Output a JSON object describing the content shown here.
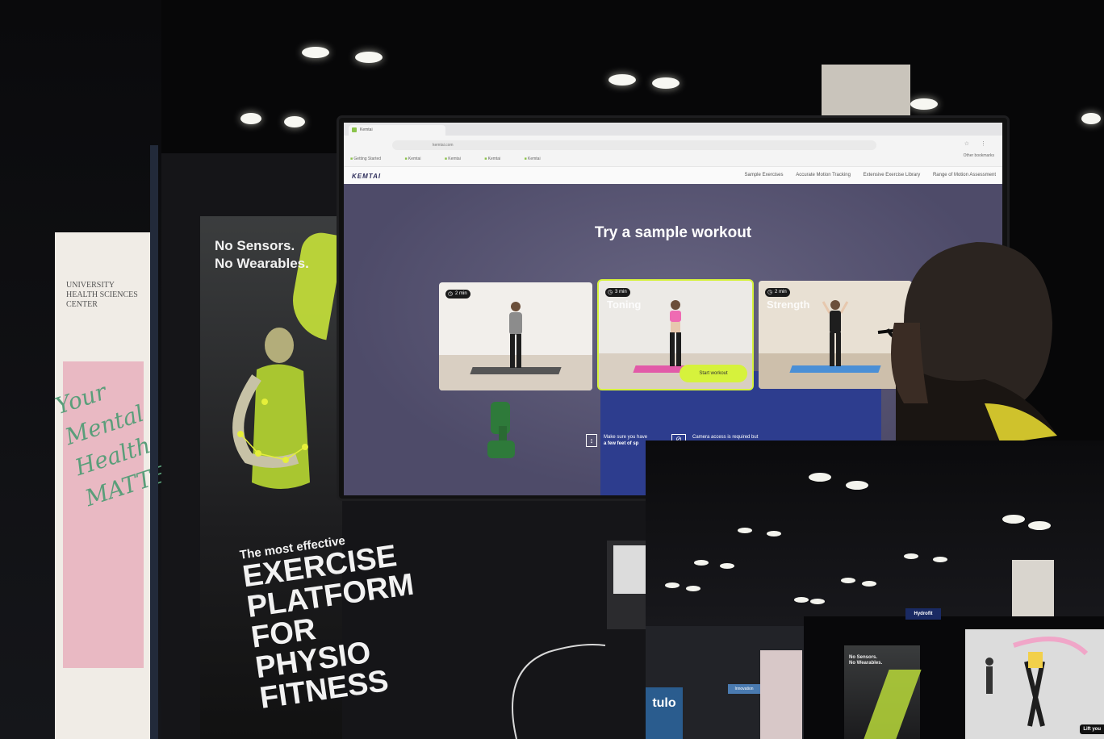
{
  "scene": {
    "booth_banner_slogan": "No Sensors.\nNo Wearables.",
    "booth_banner_tagline": "The most effective",
    "booth_banner_headline": "EXERCISE\nPLATFORM\nFOR PHYSIO\nFITNESS",
    "left_banner_text": "UNIVERSITY\nHEALTH SCIENCES CENTER",
    "left_banner_script": "Your\nMental\nHealth\nMATTERS"
  },
  "browser": {
    "tab_title": "Kemtai",
    "url": "kemtai.com",
    "bookmarks": [
      "Getting Started",
      "Kemtai",
      "Kemtai",
      "Kemtai",
      "Kemtai"
    ],
    "other_bookmarks": "Other bookmarks"
  },
  "website": {
    "logo": "KEMTAI",
    "nav": [
      "Sample Exercises",
      "Accurate Motion Tracking",
      "Extensive Exercise Library",
      "Range of Motion Assessment"
    ],
    "hero_title": "Try a sample workout",
    "cards": [
      {
        "duration": "2 min",
        "name": "",
        "selected": false
      },
      {
        "duration": "3 min",
        "name": "Toning",
        "selected": true
      },
      {
        "duration": "2 min",
        "name": "Strength",
        "selected": false
      }
    ],
    "start_button": "Start workout",
    "info": [
      {
        "icon": "space-icon",
        "line1": "Make sure you have",
        "line2": "a few feet of sp"
      },
      {
        "icon": "camera-off-icon",
        "line1": "Camera access is required but",
        "line2": ""
      }
    ]
  },
  "inset": {
    "booth_sign": "Hydrofit",
    "banner_slogan": "No Sensors.\nNo Wearables.",
    "screen_caption": "Lift you",
    "left_logo": "tulo",
    "innovation_sign": "Innovation"
  },
  "colors": {
    "accent": "#d6f23c",
    "hero_bg": "#5a5878",
    "panel_blue": "#2d3d8e",
    "brand_navy": "#2d2d5a"
  }
}
